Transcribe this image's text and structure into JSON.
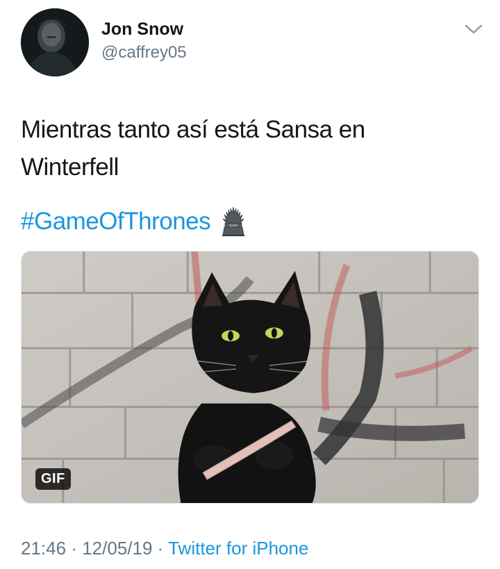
{
  "tweet": {
    "author": {
      "display_name": "Jon Snow",
      "handle": "@caffrey05"
    },
    "text_line1": "Mientras tanto así está Sansa en",
    "text_line2": "Winterfell",
    "hashtag": "#GameOfThrones",
    "hashtag_emoji": "iron-throne-emoji",
    "media": {
      "badge": "GIF"
    },
    "time": "21:46",
    "date": "12/05/19",
    "separator": "·",
    "source": "Twitter for iPhone"
  },
  "colors": {
    "text": "#14171a",
    "secondary": "#657786",
    "link": "#1b95e0"
  }
}
